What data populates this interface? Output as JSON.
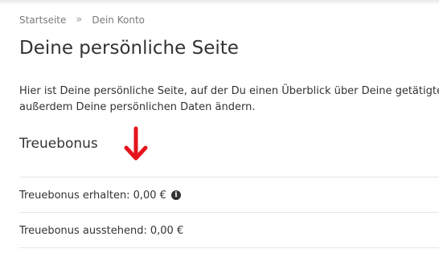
{
  "breadcrumb": {
    "items": [
      "Startseite",
      "Dein Konto"
    ],
    "separator": "»"
  },
  "page_title": "Deine persönliche Seite",
  "intro": {
    "line1": "Hier ist Deine persönliche Seite, auf der Du einen Überblick über Deine getätigten",
    "line2": "außerdem Deine persönlichen Daten ändern."
  },
  "treuebonus": {
    "title": "Treuebonus",
    "annotation_arrow_color": "#e4141b",
    "received_label": "Treuebonus erhalten:",
    "received_value": "0,00 €",
    "pending_label": "Treuebonus ausstehend:",
    "pending_value": "0,00 €",
    "info_icon": "info-circle-icon"
  }
}
